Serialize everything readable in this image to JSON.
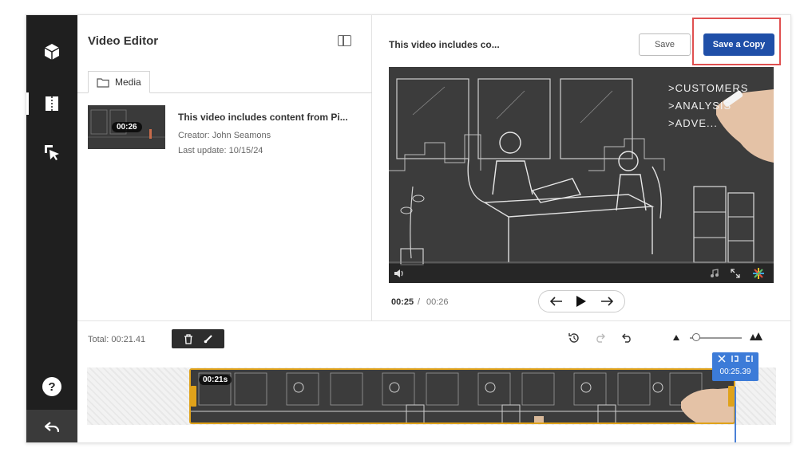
{
  "app": {
    "title": "Video Editor"
  },
  "media_panel": {
    "tab_label": "Media",
    "item": {
      "thumb_duration": "00:26",
      "title": "This video includes content from Pi...",
      "creator": "Creator: John Seamons",
      "last_update": "Last update: 10/15/24"
    }
  },
  "preview": {
    "title": "This video includes co...",
    "save_label": "Save",
    "save_copy_label": "Save a Copy",
    "time_current": "00:25",
    "time_separator": "/",
    "time_total": "00:26",
    "video_text": [
      ">CUSTOMERS",
      ">ANALYSIS",
      ">ADVE..."
    ]
  },
  "timeline": {
    "total_label": "Total: 00:21.41",
    "clip_duration": "00:21s",
    "playhead_time": "00:25.39"
  },
  "colors": {
    "accent": "#1f4fa8",
    "highlight": "#e05050",
    "clip_border": "#e0a21a",
    "playhead": "#3c7bd8",
    "rail_bg": "#1f1f1f"
  },
  "icons": {
    "rail": [
      "cube-icon",
      "book-icon",
      "cursor-select-icon",
      "help-icon",
      "undo-back-icon"
    ],
    "panel_toggle": "sidebar-toggle-icon",
    "tab": "folder-icon",
    "player": [
      "arrow-left-icon",
      "play-icon",
      "arrow-right-icon",
      "volume-icon",
      "music-icon",
      "fullscreen-icon",
      "logo-icon"
    ],
    "timeline": [
      "trash-icon",
      "split-icon",
      "history-icon",
      "redo-icon",
      "undo-icon",
      "zoom-out-icon",
      "zoom-in-icon",
      "scissors-icon",
      "trim-start-icon",
      "trim-end-icon"
    ]
  }
}
